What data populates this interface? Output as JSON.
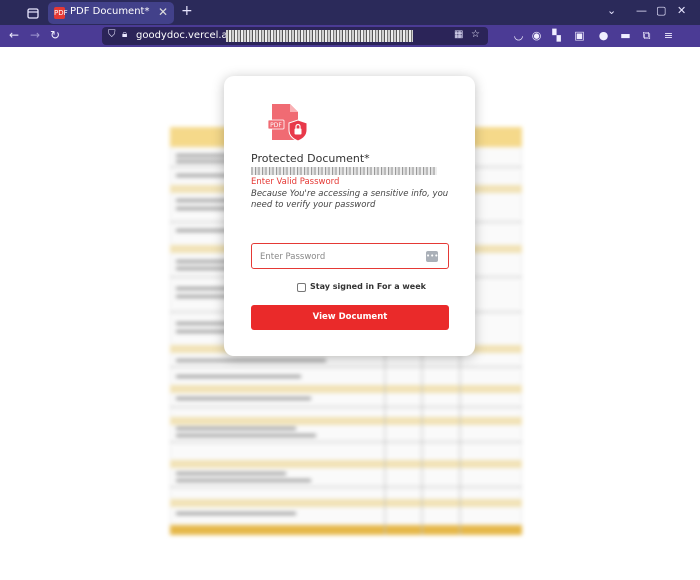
{
  "browser": {
    "tab_title": "PDF Document*",
    "tab_favicon_text": "PDF",
    "url_domain": "goodydoc.vercel.app/",
    "accent_color": "#4b3b95"
  },
  "document": {
    "modal_title": "Protected Document*",
    "icon_label": "PDF",
    "error_text": "Enter Valid Password",
    "hint_text": "Because You're accessing a sensitive info, you need to verify your password",
    "password_placeholder": "Enter Password",
    "password_value": "",
    "stay_signed_in_label": "Stay signed in For a week",
    "stay_signed_in_checked": false,
    "view_button_label": "View Document",
    "error_color": "#e53935",
    "button_color": "#ea2a2a"
  }
}
